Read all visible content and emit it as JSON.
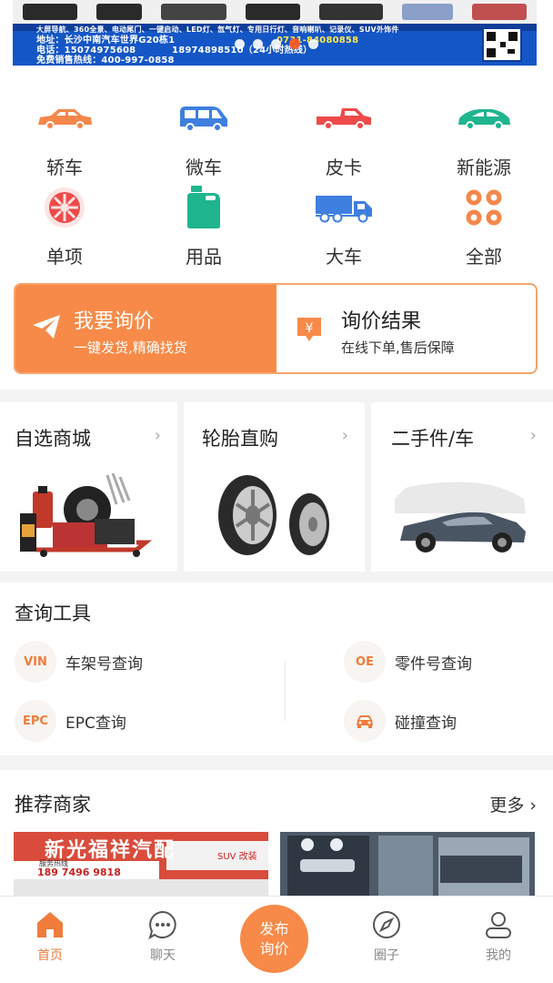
{
  "banner": {
    "line1": "大屏导航、360全景、电动尾门、一键启动、LED灯、氙气灯、专用日行灯、音响喇叭、记录仪、SUV外饰件",
    "line2_prefix": "地址：长沙中南汽车世界G20栋1",
    "line2_suffix": "0731-84080858",
    "line3_prefix": "电话：15074975608",
    "line3_suffix": "18974898510（24小时热线）",
    "line4": "免费销售热线：400-997-0858",
    "slide_count": 5,
    "active_slide": 3
  },
  "categories": [
    {
      "label": "轿车",
      "icon": "sedan-icon",
      "color": "#f5874b"
    },
    {
      "label": "微车",
      "icon": "minivan-icon",
      "color": "#3f7fe0"
    },
    {
      "label": "皮卡",
      "icon": "pickup-icon",
      "color": "#ef4a4a"
    },
    {
      "label": "新能源",
      "icon": "ev-car-icon",
      "color": "#1fb58f"
    },
    {
      "label": "单项",
      "icon": "wheel-icon",
      "color": "#ef4a4a"
    },
    {
      "label": "用品",
      "icon": "oil-can-icon",
      "color": "#1fb58f"
    },
    {
      "label": "大车",
      "icon": "truck-icon",
      "color": "#3f7fe0"
    },
    {
      "label": "全部",
      "icon": "all-grid-icon",
      "color": "#f5874b"
    }
  ],
  "inquiry": {
    "request_title": "我要询价",
    "request_sub": "一键发货,精确找货",
    "result_title": "询价结果",
    "result_sub": "在线下单,售后保障",
    "accent": "#f78a48"
  },
  "tiles": [
    {
      "title": "自选商城",
      "arrow": "›"
    },
    {
      "title": "轮胎直购",
      "arrow": "›"
    },
    {
      "title": "二手件/车",
      "arrow": "›"
    }
  ],
  "tools": {
    "heading": "查询工具",
    "items": [
      {
        "badge": "VIN",
        "label": "车架号查询"
      },
      {
        "badge": "OE",
        "label": "零件号查询"
      },
      {
        "badge": "EPC",
        "label": "EPC查询"
      },
      {
        "badge": "",
        "label": "碰撞查询"
      }
    ]
  },
  "merchants": {
    "heading": "推荐商家",
    "more": "更多 ›",
    "shop1_sign": "新光福祥汽配",
    "shop1_phone": "189 7496 9818",
    "shop1_tag": "SUV 改装",
    "shop1_hotline": "服务热线"
  },
  "nav": {
    "home": "首页",
    "chat": "聊天",
    "publish_line1": "发布",
    "publish_line2": "询价",
    "circle": "圈子",
    "mine": "我的"
  }
}
